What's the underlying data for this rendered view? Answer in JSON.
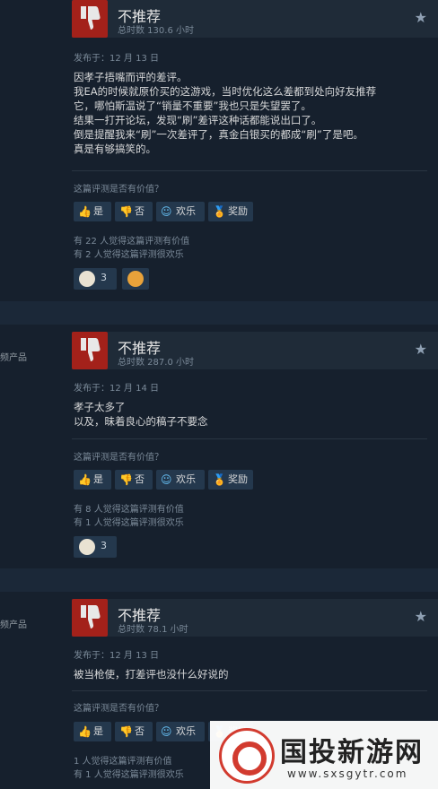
{
  "reviews": [
    {
      "left_note": "",
      "title": "不推荐",
      "hours": "总时数 130.6 小时",
      "posted": "发布于：12 月 13 日",
      "lines": [
        "因孝子捂嘴而评的差评。",
        "我EA的时候就原价买的这游戏，当时优化这么差都到处向好友推荐",
        "它，哪怕斯温说了“销量不重要”我也只是失望罢了。",
        "结果一打开论坛，发现“刷”差评这种话都能说出口了。",
        "倒是提醒我来“刷”一次差评了，真金白银买的都成“刷”了是吧。",
        "真是有够搞笑的。"
      ],
      "question": "这篇评测是否有价值？",
      "btn_yes": "是",
      "btn_no": "否",
      "btn_funny": "欢乐",
      "btn_award": "奖励",
      "helpful": "有 22 人觉得这篇评测有价值",
      "funny": "有 2 人觉得这篇评测很欢乐",
      "award_count": "3"
    },
    {
      "left_note": "频产品",
      "title": "不推荐",
      "hours": "总时数 287.0 小时",
      "posted": "发布于：12 月 14 日",
      "lines": [
        "孝子太多了",
        "以及，昧着良心的稿子不要念"
      ],
      "question": "这篇评测是否有价值？",
      "btn_yes": "是",
      "btn_no": "否",
      "btn_funny": "欢乐",
      "btn_award": "奖励",
      "helpful": "有 8 人觉得这篇评测有价值",
      "funny": "有 1 人觉得这篇评测很欢乐",
      "award_count": "3"
    },
    {
      "left_note": "频产品",
      "title": "不推荐",
      "hours": "总时数 78.1 小时",
      "posted": "发布于：12 月 13 日",
      "lines": [
        "被当枪使，打差评也没什么好说的"
      ],
      "question": "这篇评测是否有价值？",
      "btn_yes": "是",
      "btn_no": "否",
      "btn_funny": "欢乐",
      "btn_award": "奖励",
      "helpful": "1 人觉得这篇评测有价值",
      "funny": "有 1 人觉得这篇评测很欢乐"
    }
  ],
  "watermark": {
    "title": "国投新游网",
    "url": "www.sxsgytr.com"
  },
  "colors": {
    "thumb_down": "#a3211a",
    "link_blue": "#67c1f5",
    "page_bg": "#1b2838",
    "card_bg": "#16202d"
  },
  "icons": [
    "thumbs-down-icon",
    "star-icon",
    "thumbs-up-icon",
    "smile-icon",
    "award-icon"
  ]
}
